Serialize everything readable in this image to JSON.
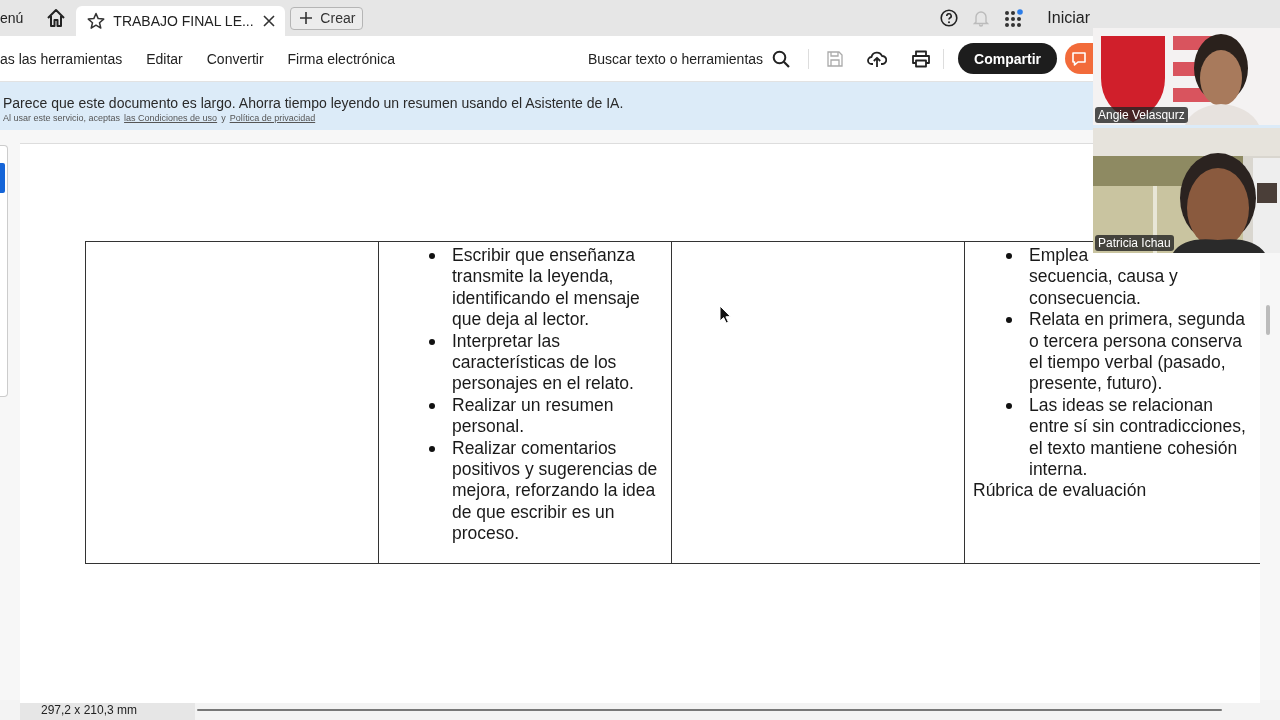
{
  "tab_bar": {
    "menu_label": "enú",
    "tabs": [
      {
        "title": "TRABAJO FINAL LE...",
        "selected": true
      }
    ],
    "new_button": "Crear",
    "sign_in": "Iniciar"
  },
  "toolbar": {
    "menu_items": [
      "as las herramientas",
      "Editar",
      "Convertir",
      "Firma electrónica"
    ],
    "search_label": "Buscar texto o herramientas",
    "share_button": "Compartir"
  },
  "banner": {
    "message": "Parece que este documento es largo. Ahorra tiempo leyendo un resumen usando el Asistente de IA.",
    "note": "Al usar este servicio, aceptas",
    "link_1": "las Condiciones de uso",
    "separator": "y",
    "link_2": "Política de privacidad"
  },
  "document": {
    "table": {
      "rows": [
        {
          "cells": [
            {
              "kind": "empty"
            },
            {
              "kind": "list",
              "items": [
                "Escribir que enseñanza transmite la leyenda, identificando el mensaje que deja al lector.",
                "Interpretar las características de los personajes en el relato.",
                "Realizar un resumen personal.",
                "Realizar comentarios positivos y sugerencias de mejora, reforzando la idea de que escribir es un proceso."
              ]
            },
            {
              "kind": "empty"
            },
            {
              "kind": "list",
              "items": [
                "Emplea\nsecuencia, causa y consecuencia.",
                "Relata en primera, segunda o tercera persona conserva el tiempo verbal (pasado, presente, futuro).",
                "Las ideas se relacionan entre sí sin contradicciones, el texto mantiene cohesión interna."
              ],
              "after": "Rúbrica de evaluación"
            }
          ]
        }
      ]
    }
  },
  "status_bar": {
    "page_size": "297,2 x 210,3 mm"
  },
  "video_call": {
    "participants": [
      {
        "name": "Angie Velasqurz",
        "kind": "logo-wall"
      },
      {
        "name": "Patricia Ichau",
        "kind": "curtains"
      }
    ]
  }
}
